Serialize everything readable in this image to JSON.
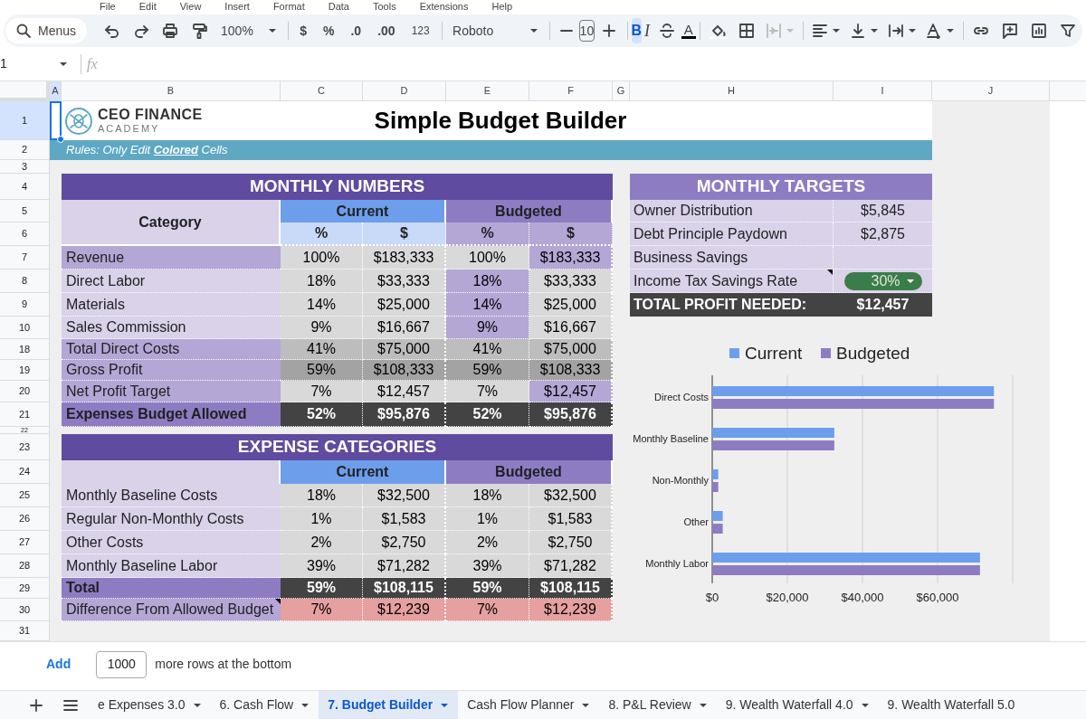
{
  "menu_bar": [
    "File",
    "Edit",
    "View",
    "Insert",
    "Format",
    "Data",
    "Tools",
    "Extensions",
    "Help"
  ],
  "toolbar": {
    "search": "Menus",
    "zoom": "100%",
    "currency": "$",
    "percent": "%",
    "decrease_decimals": ".0",
    "increase_decimals": ".00",
    "number_format": "123",
    "font": "Roboto",
    "font_size": "10",
    "bold": "B",
    "italic": "I",
    "text_color": "A",
    "bold_active": true
  },
  "formula_bar": {
    "cell": "1",
    "fx": "fx"
  },
  "columns": [
    {
      "label": "A",
      "selected": true
    },
    {
      "label": "B",
      "selected": false
    },
    {
      "label": "C",
      "selected": false
    },
    {
      "label": "D",
      "selected": false
    },
    {
      "label": "E",
      "selected": false
    },
    {
      "label": "F",
      "selected": false
    },
    {
      "label": "G",
      "selected": false
    },
    {
      "label": "H",
      "selected": false
    },
    {
      "label": "I",
      "selected": false
    },
    {
      "label": "J",
      "selected": false
    }
  ],
  "rows": [
    {
      "label": "1",
      "selected": true
    },
    {
      "label": "2",
      "selected": false
    },
    {
      "label": "3",
      "selected": false
    },
    {
      "label": "4",
      "selected": false
    },
    {
      "label": "5",
      "selected": false
    },
    {
      "label": "6",
      "selected": false
    },
    {
      "label": "7",
      "selected": false
    },
    {
      "label": "8",
      "selected": false
    },
    {
      "label": "9",
      "selected": false
    },
    {
      "label": "10",
      "selected": false
    },
    {
      "label": "18",
      "selected": false
    },
    {
      "label": "19",
      "selected": false
    },
    {
      "label": "20",
      "selected": false
    },
    {
      "label": "21",
      "selected": false
    },
    {
      "label": "22",
      "selected": false
    },
    {
      "label": "23",
      "selected": false
    },
    {
      "label": "24",
      "selected": false
    },
    {
      "label": "25",
      "selected": false
    },
    {
      "label": "26",
      "selected": false
    },
    {
      "label": "27",
      "selected": false
    },
    {
      "label": "28",
      "selected": false
    },
    {
      "label": "29",
      "selected": false
    },
    {
      "label": "30",
      "selected": false
    },
    {
      "label": "31",
      "selected": false
    }
  ],
  "header": {
    "logo_top": "CEO FINANCE",
    "logo_bottom": "ACADEMY",
    "title": "Simple Budget Builder",
    "rules": "Rules: Only Edit **Colored** Cells"
  },
  "monthly_numbers": {
    "title": "MONTHLY NUMBERS",
    "category_header": "Category",
    "groups": [
      "Current",
      "Budgeted"
    ],
    "subheaders": [
      "%",
      "$",
      "%",
      "$"
    ],
    "rows": [
      {
        "label": "Revenue",
        "kind": "key",
        "cells": [
          {
            "text": "100%",
            "editable": false
          },
          {
            "text": "$183,333",
            "editable": false
          },
          {
            "text": "100%",
            "editable": false
          },
          {
            "text": "$183,333",
            "editable": true
          }
        ]
      },
      {
        "label": "Direct Labor",
        "kind": "line",
        "cells": [
          {
            "text": "18%",
            "editable": false
          },
          {
            "text": "$33,333",
            "editable": false
          },
          {
            "text": "18%",
            "editable": true
          },
          {
            "text": "$33,333",
            "editable": false
          }
        ]
      },
      {
        "label": "Materials",
        "kind": "line",
        "cells": [
          {
            "text": "14%",
            "editable": false
          },
          {
            "text": "$25,000",
            "editable": false
          },
          {
            "text": "14%",
            "editable": true
          },
          {
            "text": "$25,000",
            "editable": false
          }
        ]
      },
      {
        "label": "Sales Commission",
        "kind": "line",
        "cells": [
          {
            "text": "9%",
            "editable": false
          },
          {
            "text": "$16,667",
            "editable": false
          },
          {
            "text": "9%",
            "editable": true
          },
          {
            "text": "$16,667",
            "editable": false
          }
        ]
      },
      {
        "label": "Total Direct Costs",
        "kind": "subtotal",
        "cells": [
          {
            "text": "41%",
            "editable": false
          },
          {
            "text": "$75,000",
            "editable": false
          },
          {
            "text": "41%",
            "editable": false
          },
          {
            "text": "$75,000",
            "editable": false
          }
        ]
      },
      {
        "label": "Gross Profit",
        "kind": "gross",
        "cells": [
          {
            "text": "59%",
            "editable": false
          },
          {
            "text": "$108,333",
            "editable": false
          },
          {
            "text": "59%",
            "editable": false
          },
          {
            "text": "$108,333",
            "editable": false
          }
        ]
      },
      {
        "label": "Net Profit Target",
        "kind": "key",
        "cells": [
          {
            "text": "7%",
            "editable": false
          },
          {
            "text": "$12,457",
            "editable": false
          },
          {
            "text": "7%",
            "editable": false
          },
          {
            "text": "$12,457",
            "editable": true
          }
        ]
      },
      {
        "label": "Expenses Budget Allowed",
        "kind": "total",
        "cells": [
          {
            "text": "52%",
            "editable": false
          },
          {
            "text": "$95,876",
            "editable": false
          },
          {
            "text": "52%",
            "editable": false
          },
          {
            "text": "$95,876",
            "editable": false
          }
        ]
      }
    ]
  },
  "expense_categories": {
    "title": "EXPENSE CATEGORIES",
    "groups": [
      "Current",
      "Budgeted"
    ],
    "rows": [
      {
        "label": "Monthly Baseline Costs",
        "kind": "line",
        "cells": [
          {
            "text": "18%",
            "editable": false
          },
          {
            "text": "$32,500",
            "editable": false
          },
          {
            "text": "18%",
            "editable": false
          },
          {
            "text": "$32,500",
            "editable": false
          }
        ]
      },
      {
        "label": "Regular Non-Monthly Costs",
        "kind": "line",
        "cells": [
          {
            "text": "1%",
            "editable": false
          },
          {
            "text": "$1,583",
            "editable": false
          },
          {
            "text": "1%",
            "editable": false
          },
          {
            "text": "$1,583",
            "editable": false
          }
        ]
      },
      {
        "label": "Other Costs",
        "kind": "line",
        "cells": [
          {
            "text": "2%",
            "editable": false
          },
          {
            "text": "$2,750",
            "editable": false
          },
          {
            "text": "2%",
            "editable": false
          },
          {
            "text": "$2,750",
            "editable": false
          }
        ]
      },
      {
        "label": "Monthly Baseline Labor",
        "kind": "line",
        "cells": [
          {
            "text": "39%",
            "editable": false
          },
          {
            "text": "$71,282",
            "editable": false
          },
          {
            "text": "39%",
            "editable": false
          },
          {
            "text": "$71,282",
            "editable": false
          }
        ]
      },
      {
        "label": "Total",
        "kind": "total",
        "cells": [
          {
            "text": "59%",
            "editable": false
          },
          {
            "text": "$108,115",
            "editable": false
          },
          {
            "text": "59%",
            "editable": false
          },
          {
            "text": "$108,115",
            "editable": false
          }
        ]
      },
      {
        "label": "Difference From Allowed Budget",
        "kind": "diff",
        "has_note": true,
        "cells": [
          {
            "text": "7%",
            "editable": false
          },
          {
            "text": "$12,239",
            "editable": false
          },
          {
            "text": "7%",
            "editable": false
          },
          {
            "text": "$12,239",
            "editable": false
          }
        ]
      }
    ]
  },
  "monthly_targets": {
    "title": "MONTHLY TARGETS",
    "rows": [
      {
        "label": "Owner Distribution",
        "kind": "text",
        "value": "$5,845"
      },
      {
        "label": "Debt Principle Paydown",
        "kind": "text",
        "value": "$2,875"
      },
      {
        "label": "Business Savings",
        "kind": "text"
      },
      {
        "label": "Income Tax Savings Rate",
        "kind": "dropdown",
        "value": "30%",
        "has_note": true
      }
    ],
    "total": {
      "label": "TOTAL PROFIT NEEDED:",
      "value": "$12,457"
    }
  },
  "chart_data": {
    "type": "bar",
    "orientation": "horizontal",
    "categories": [
      "Direct Costs",
      "Monthly Baseline",
      "Non-Monthly",
      "Other",
      "Monthly Labor"
    ],
    "series": [
      {
        "name": "Current",
        "color": "#6d9eeb",
        "values": [
          75000,
          32500,
          1600,
          2800,
          71300
        ]
      },
      {
        "name": "Budgeted",
        "color": "#8e7cc3",
        "values": [
          75000,
          32500,
          1600,
          2800,
          71300
        ]
      }
    ],
    "grid": true,
    "legend": true,
    "xlim": [
      0,
      80000
    ],
    "xticks": [
      {
        "value": 0,
        "label": "$0"
      },
      {
        "value": 20000,
        "label": "$20,000"
      },
      {
        "value": 40000,
        "label": "$40,000"
      },
      {
        "value": 60000,
        "label": "$60,000"
      }
    ]
  },
  "add_rows": {
    "button": "Add",
    "count": "1000",
    "suffix": "more rows at the bottom"
  },
  "sheet_tabs": [
    {
      "label": "e Expenses 3.0",
      "selected": false
    },
    {
      "label": "6. Cash Flow",
      "selected": false
    },
    {
      "label": "7. Budget Builder",
      "selected": true
    },
    {
      "label": "Cash Flow Planner",
      "selected": false
    },
    {
      "label": "8. P&L Review",
      "selected": false
    },
    {
      "label": "9. Wealth Waterfall 4.0",
      "selected": false
    },
    {
      "label": "9. Wealth Waterfall 5.0",
      "selected": false
    }
  ]
}
